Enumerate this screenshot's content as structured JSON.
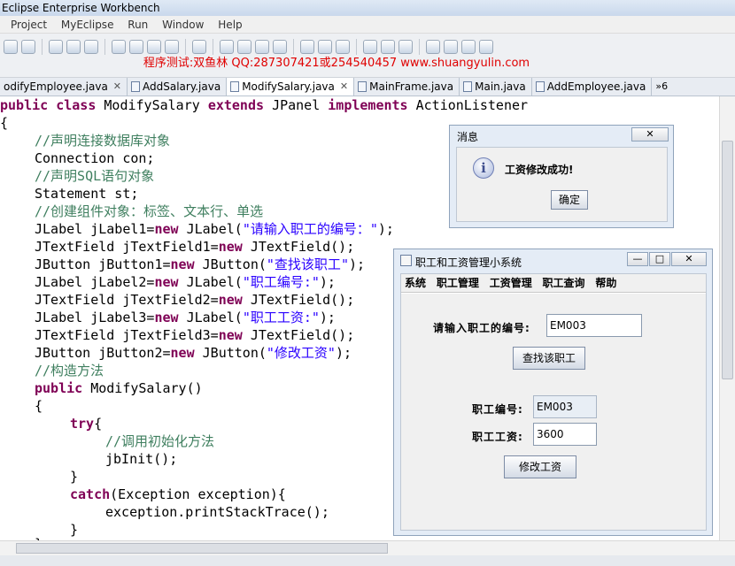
{
  "window": {
    "title": "Eclipse Enterprise Workbench"
  },
  "menu": [
    "Project",
    "MyEclipse",
    "Run",
    "Window",
    "Help"
  ],
  "watermark_text": "程序测试:双鱼林 QQ:287307421或254540457 www.shuangyulin.com",
  "tabs": [
    {
      "label": "odifyEmployee.java",
      "closable": true,
      "active": false
    },
    {
      "label": "AddSalary.java",
      "closable": false,
      "active": false
    },
    {
      "label": "ModifySalary.java",
      "closable": true,
      "active": true
    },
    {
      "label": "MainFrame.java",
      "closable": false,
      "active": false
    },
    {
      "label": "Main.java",
      "closable": false,
      "active": false
    },
    {
      "label": "AddEmployee.java",
      "closable": false,
      "active": false
    }
  ],
  "tabs_overflow": "»6",
  "code": {
    "line1": {
      "kw1": "public",
      "kw2": "class",
      "name": "ModifySalary",
      "kw3": "extends",
      "base": "JPanel",
      "kw4": "implements",
      "iface": "ActionListener"
    },
    "line2": "{",
    "line3": "//声明连接数据库对象",
    "line4": "Connection con;",
    "line5": "//声明SQL语句对象",
    "line6": "Statement st;",
    "line7": "//创建组件对象：标签、文本行、单选",
    "line8": {
      "pre": "JLabel jLabel1=",
      "kw": "new",
      "mid": " JLabel(",
      "str": "\"请输入职工的编号：\"",
      "post": ");"
    },
    "line9": {
      "pre": "JTextField jTextField1=",
      "kw": "new",
      "post": " JTextField();"
    },
    "line10": {
      "pre": "JButton jButton1=",
      "kw": "new",
      "mid": " JButton(",
      "str": "\"查找该职工\"",
      "post": ");"
    },
    "line11": {
      "pre": "JLabel jLabel2=",
      "kw": "new",
      "mid": " JLabel(",
      "str": "\"职工编号:\"",
      "post": ");"
    },
    "line12": {
      "pre": "JTextField jTextField2=",
      "kw": "new",
      "post": " JTextField();"
    },
    "line13": {
      "pre": "JLabel jLabel3=",
      "kw": "new",
      "mid": " JLabel(",
      "str": "\"职工工资:\"",
      "post": ");"
    },
    "line14": {
      "pre": "JTextField jTextField3=",
      "kw": "new",
      "post": " JTextField();"
    },
    "line15": {
      "pre": "JButton jButton2=",
      "kw": "new",
      "mid": " JButton(",
      "str": "\"修改工资\"",
      "post": ");"
    },
    "line16": "//构造方法",
    "line17": {
      "kw": "public",
      "post": " ModifySalary()"
    },
    "line18": "{",
    "line19": {
      "kw": "try",
      "post": "{"
    },
    "line20": "//调用初始化方法",
    "line21": "jbInit();",
    "line22": "}",
    "line23": {
      "kw": "catch",
      "post": "(Exception exception){"
    },
    "line24": "exception.printStackTrace();",
    "line25": "}",
    "line26": "}"
  },
  "message_dialog": {
    "title": "消息",
    "close_label": "✕",
    "icon_glyph": "i",
    "message": "工资修改成功!",
    "ok_label": "确定"
  },
  "app_window": {
    "title": "职工和工资管理小系统",
    "minimize_label": "—",
    "maximize_label": "□",
    "close_label": "✕",
    "menu": [
      "系统",
      "职工管理",
      "工资管理",
      "职工查询",
      "帮助"
    ],
    "search_label": "请输入职工的编号:",
    "search_value": "EM003",
    "find_button": "查找该职工",
    "id_label": "职工编号:",
    "id_value": "EM003",
    "salary_label": "职工工资:",
    "salary_value": "3600",
    "modify_button": "修改工资"
  },
  "colors": {
    "keyword": "#7f0055",
    "string": "#2a00ff",
    "comment": "#3f7f5f",
    "watermark": "#e00000"
  }
}
